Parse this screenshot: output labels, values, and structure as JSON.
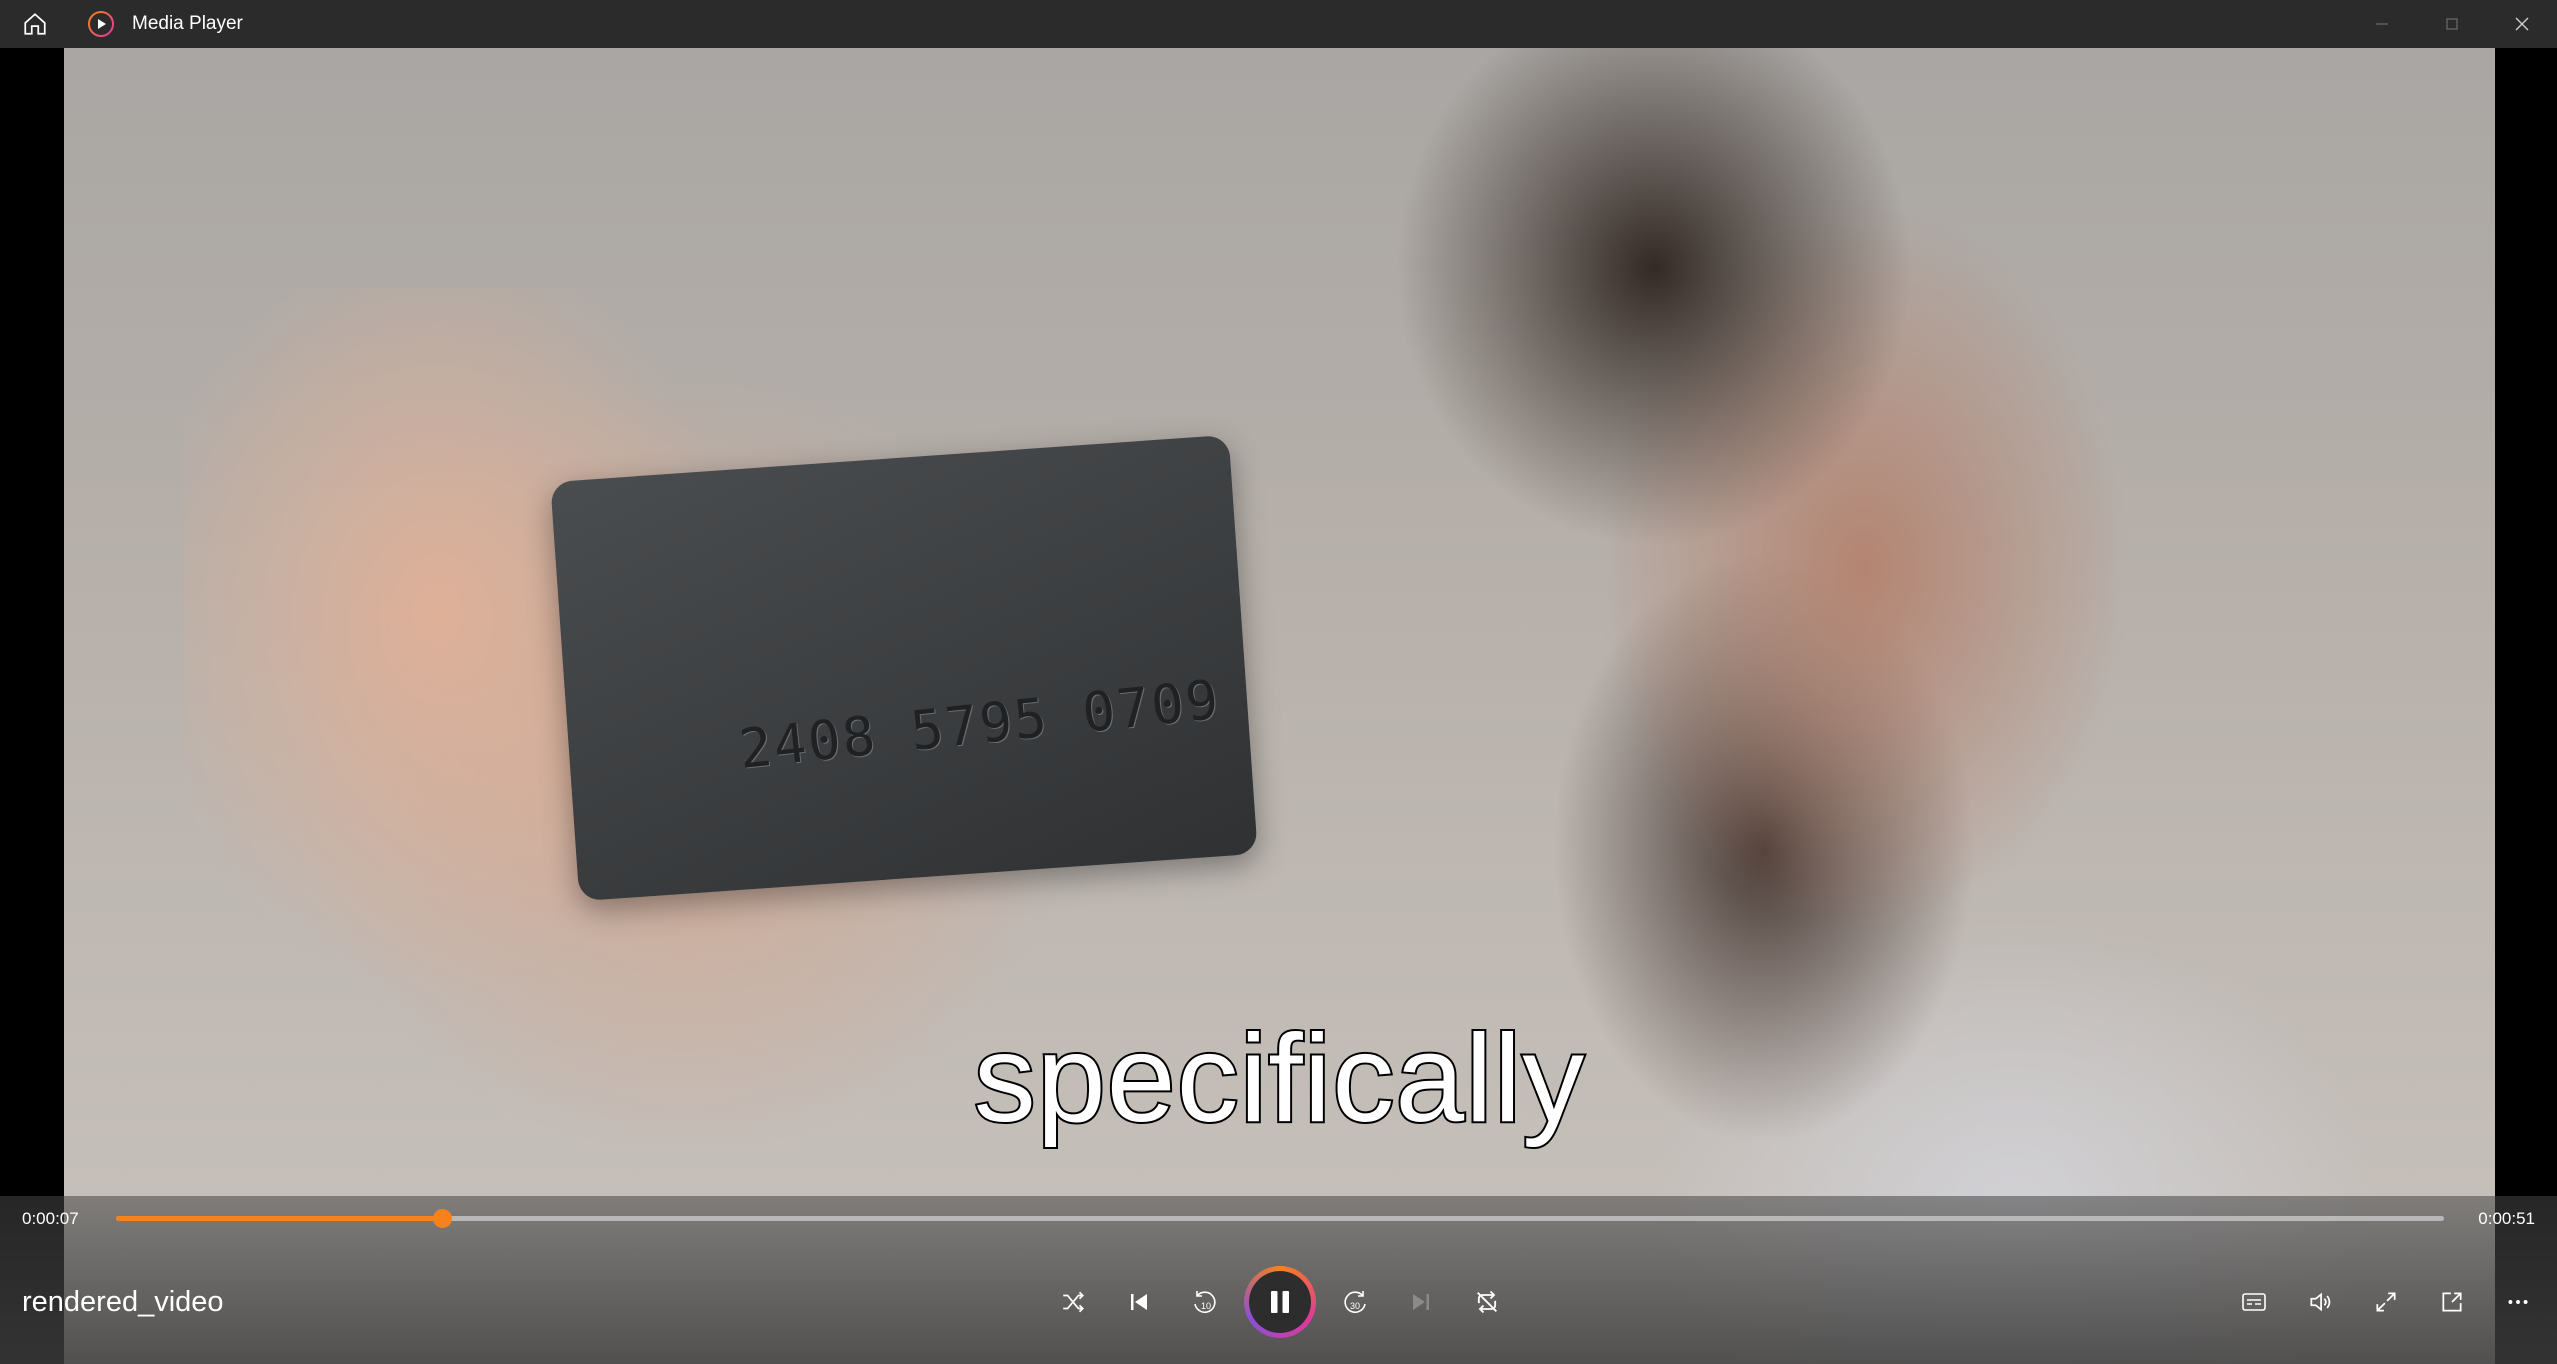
{
  "app": {
    "title": "Media Player",
    "icons": {
      "home": "home-icon",
      "logo": "media-player-logo-icon",
      "minimize": "minimize-icon",
      "maximize": "maximize-icon",
      "close": "close-icon"
    }
  },
  "video": {
    "subtitle": "specifically",
    "card_number": "2408 5795 0709"
  },
  "playback": {
    "current_time": "0:00:07",
    "duration": "0:00:51",
    "progress": 0.14,
    "accent_color": "#f7821b"
  },
  "media": {
    "title": "rendered_video"
  },
  "controls": {
    "center": [
      "shuffle-icon",
      "previous-icon",
      "skip-back-10-icon",
      "pause-icon",
      "skip-forward-30-icon",
      "next-icon",
      "repeat-off-icon"
    ],
    "skip_back_label": "10",
    "skip_forward_label": "30",
    "right": [
      "subtitles-icon",
      "volume-icon",
      "fullscreen-icon",
      "mini-player-icon",
      "more-icon"
    ]
  }
}
